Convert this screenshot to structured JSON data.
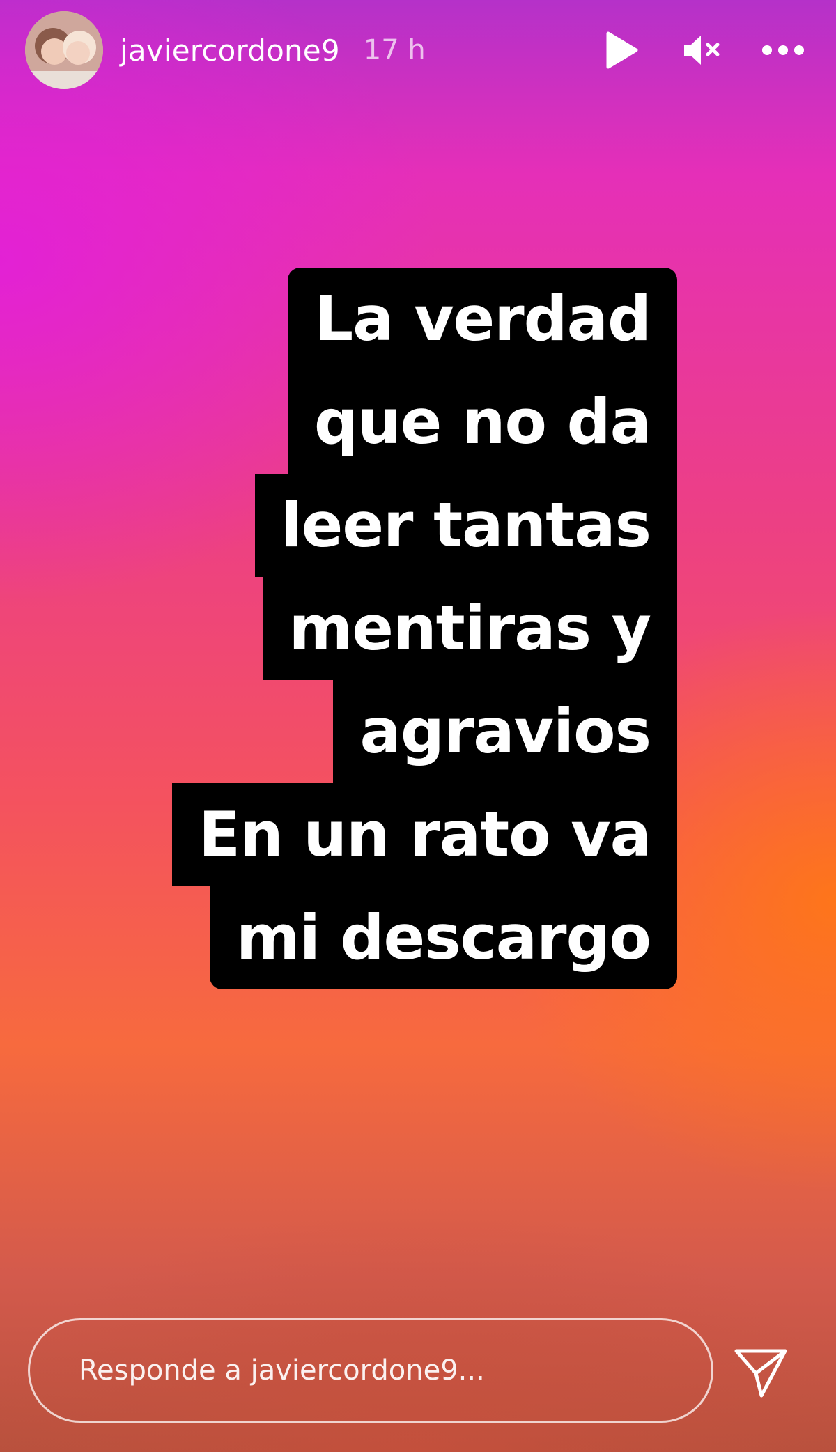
{
  "header": {
    "username": "javiercordone9",
    "time": "17 h",
    "icons": {
      "play": "play-icon",
      "mute": "speaker-muted-icon",
      "more": "more-options-icon"
    }
  },
  "story": {
    "lines": [
      "La verdad",
      "que no da",
      "leer tantas",
      "mentiras y",
      "agravios",
      "En un rato va",
      "mi descargo"
    ],
    "text_color": "#ffffff",
    "highlight_color": "#000000"
  },
  "reply": {
    "placeholder": "Responde a javiercordone9..."
  },
  "colors": {
    "gradient_top": "#b531c9",
    "gradient_magenta": "#e52fb8",
    "gradient_pink": "#ec3f86",
    "gradient_orange": "#f76a3e"
  }
}
